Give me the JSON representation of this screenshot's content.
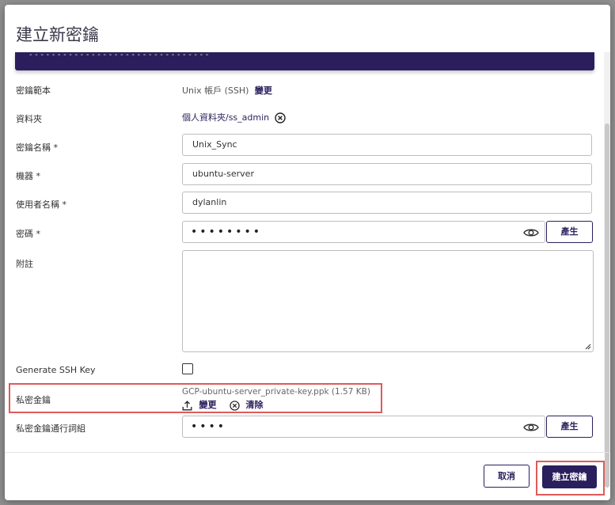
{
  "dialog": {
    "title": "建立新密鑰",
    "banner_text": "- - - - - - - - - - - - - - - - - - - - - - - - - - - - - - - -"
  },
  "form": {
    "template": {
      "label": "密鑰範本",
      "value": "Unix 帳戶 (SSH)",
      "change_link": "變更"
    },
    "folder": {
      "label": "資料夾",
      "value": "個人資料夾/ss_admin"
    },
    "secret_name": {
      "label": "密鑰名稱 *",
      "value": "Unix_Sync"
    },
    "machine": {
      "label": "機器 *",
      "value": "ubuntu-server"
    },
    "username": {
      "label": "使用者名稱 *",
      "value": "dylanlin"
    },
    "password": {
      "label": "密碼 *",
      "value": "••••••••",
      "generate_label": "產生"
    },
    "notes": {
      "label": "附註",
      "value": ""
    },
    "generate_ssh_key": {
      "label": "Generate SSH Key",
      "checked": false
    },
    "private_key": {
      "label": "私密金鑰",
      "file_name": "GCP-ubuntu-server_private-key.ppk (1.57 KB)",
      "change_label": "變更",
      "clear_label": "清除"
    },
    "passphrase": {
      "label": "私密金鑰通行詞組",
      "value": "••••",
      "generate_label": "產生"
    }
  },
  "footer": {
    "cancel_label": "取消",
    "create_label": "建立密鑰"
  },
  "colors": {
    "accent": "#2a1f5c",
    "highlight": "#e05a5a"
  }
}
